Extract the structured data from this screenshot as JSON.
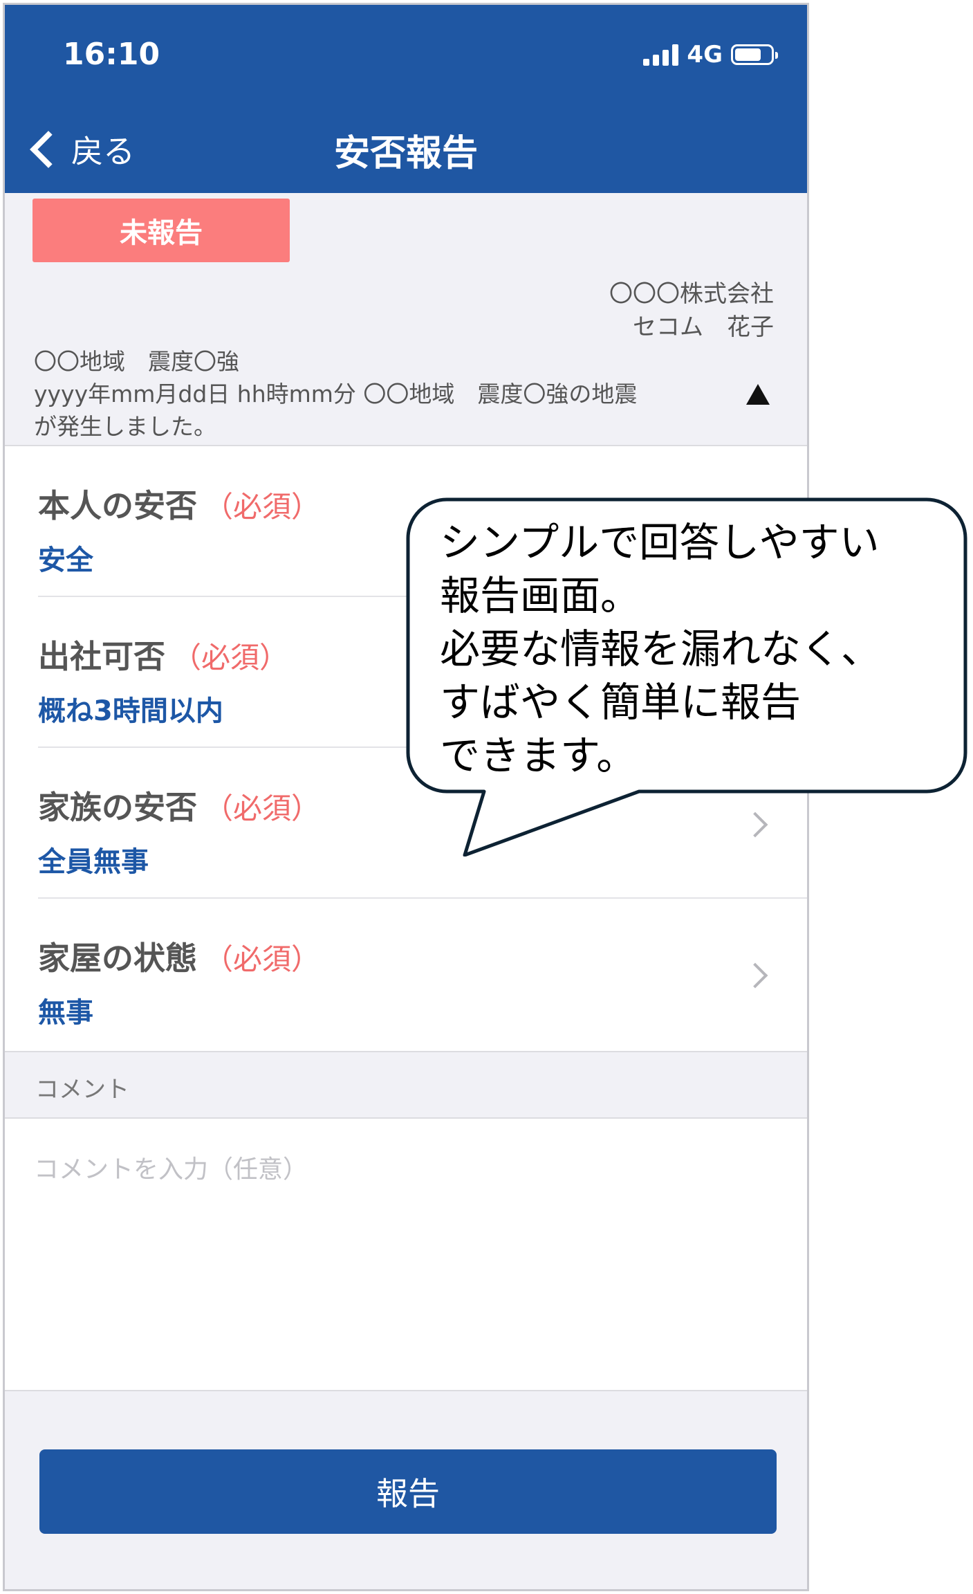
{
  "status_bar": {
    "time": "16:10",
    "network": "4G",
    "battery_level": 0.74
  },
  "nav": {
    "back_label": "戻る",
    "title": "安否報告"
  },
  "report": {
    "status_badge": "未報告",
    "company": "〇〇〇株式会社",
    "user_name": "セコム　花子",
    "notice_lines": [
      "〇〇地域　震度〇強",
      "yyyy年mm月dd日 hh時mm分 〇〇地域　震度〇強の地震",
      "が発生しました。"
    ]
  },
  "required_label": "（必須）",
  "items": [
    {
      "title": "本人の安否",
      "value": "安全"
    },
    {
      "title": "出社可否",
      "value": "概ね3時間以内"
    },
    {
      "title": "家族の安否",
      "value": "全員無事"
    },
    {
      "title": "家屋の状態",
      "value": "無事"
    }
  ],
  "comment": {
    "section_label": "コメント",
    "placeholder": "コメントを入力（任意）"
  },
  "submit_label": "報告",
  "callout_lines": [
    "シンプルで回答しやすい",
    "報告画面。",
    "必要な情報を漏れなく、",
    "すばやく簡単に報告",
    "できます。"
  ],
  "colors": {
    "header_blue": "#1f57a3",
    "badge_red": "#fb7d7d",
    "required_red": "#f06a6a",
    "value_blue": "#1d57a6"
  },
  "icons": [
    "cellular-signal-icon",
    "battery-icon",
    "back-chevron-icon",
    "collapse-triangle-icon",
    "chevron-right-icon"
  ]
}
